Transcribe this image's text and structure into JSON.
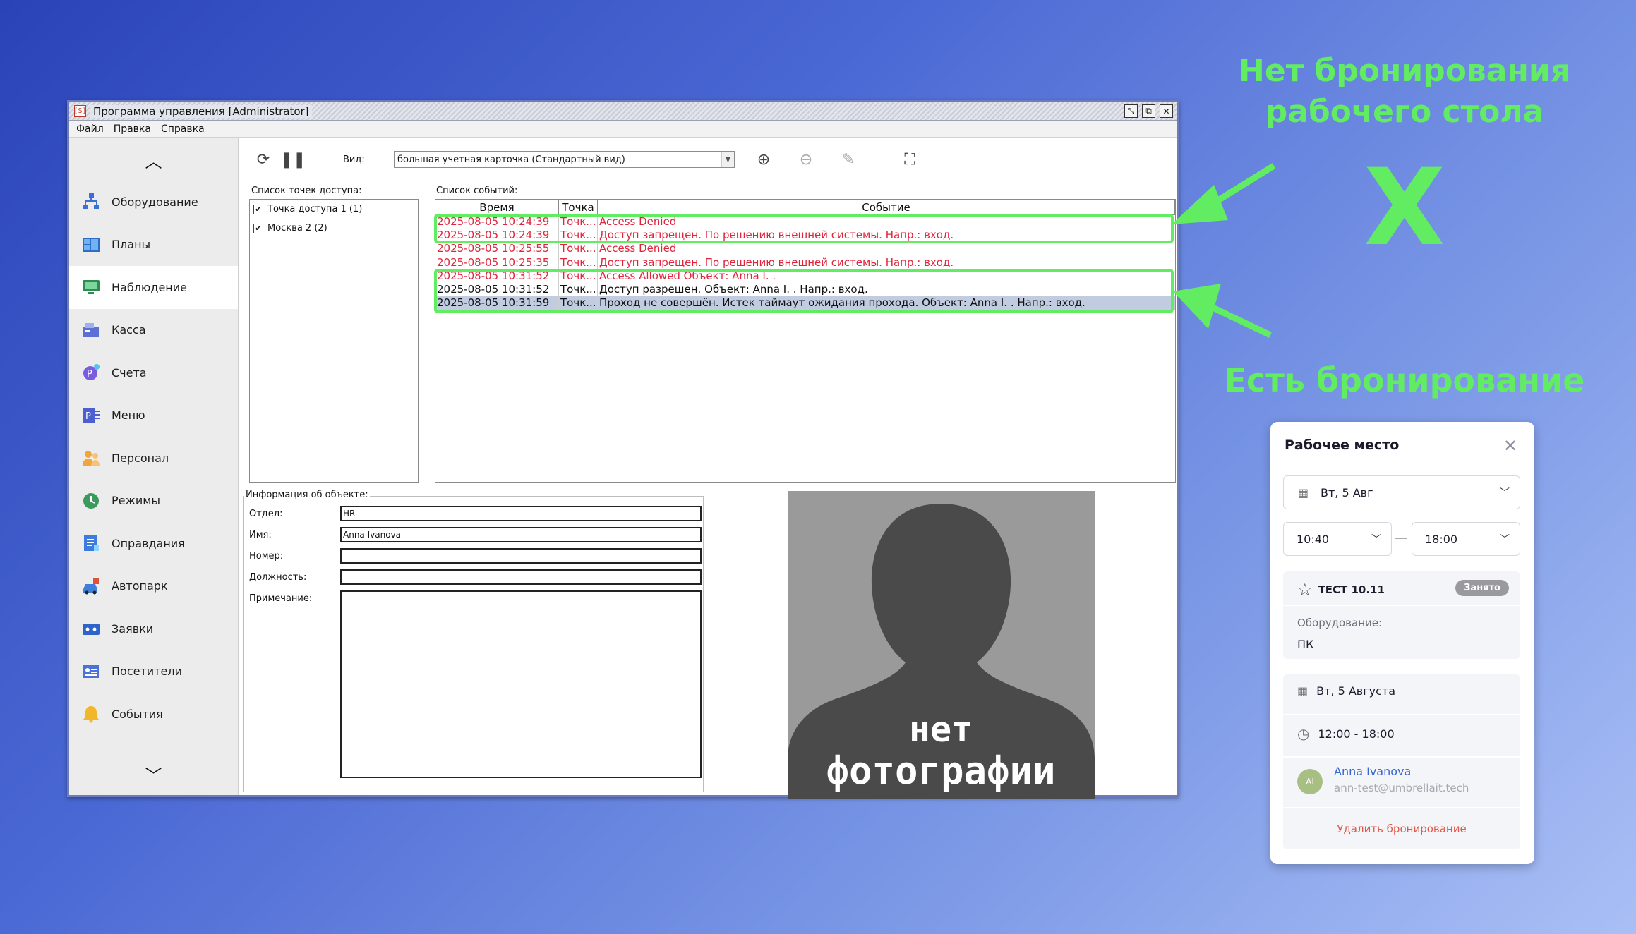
{
  "window": {
    "logo": "[S]",
    "title": "Программа управления [Administrator]",
    "menu": [
      "Файл",
      "Правка",
      "Справка"
    ]
  },
  "sidebar": {
    "items": [
      {
        "label": "Оборудование",
        "icon": "hierarchy-icon"
      },
      {
        "label": "Планы",
        "icon": "floorplan-icon"
      },
      {
        "label": "Наблюдение",
        "icon": "monitor-icon",
        "active": true
      },
      {
        "label": "Касса",
        "icon": "cash-register-icon"
      },
      {
        "label": "Счета",
        "icon": "accounts-icon"
      },
      {
        "label": "Меню",
        "icon": "menu-document-icon"
      },
      {
        "label": "Персонал",
        "icon": "staff-icon"
      },
      {
        "label": "Режимы",
        "icon": "clock-icon"
      },
      {
        "label": "Оправдания",
        "icon": "document-icon"
      },
      {
        "label": "Автопарк",
        "icon": "car-icon"
      },
      {
        "label": "Заявки",
        "icon": "requests-icon"
      },
      {
        "label": "Посетители",
        "icon": "visitors-icon"
      },
      {
        "label": "События",
        "icon": "bell-icon"
      }
    ]
  },
  "toolbar": {
    "view_label": "Вид:",
    "view_value": "большая учетная карточка (Стандартный вид)"
  },
  "access_points": {
    "label": "Список точек доступа:",
    "items": [
      "Точка доступа 1 (1)",
      "Москва 2 (2)"
    ]
  },
  "events": {
    "label": "Список событий:",
    "headers": [
      "Время",
      "Точка",
      "Событие"
    ],
    "rows": [
      {
        "time": "2025-08-05 10:24:39",
        "point": "Точк...",
        "event": "Access Denied",
        "red": true
      },
      {
        "time": "2025-08-05 10:24:39",
        "point": "Точк...",
        "event": "Доступ запрещен. По решению внешней системы. Напр.: вход.",
        "red": true
      },
      {
        "time": "2025-08-05 10:25:55",
        "point": "Точк...",
        "event": "Access Denied",
        "red": true
      },
      {
        "time": "2025-08-05 10:25:35",
        "point": "Точк...",
        "event": "Доступ запрещен. По решению внешней системы. Напр.: вход.",
        "red": true
      },
      {
        "time": "2025-08-05 10:31:52",
        "point": "Точк...",
        "event": "Access Allowed Объект: Anna I. .",
        "red": true
      },
      {
        "time": "2025-08-05 10:31:52",
        "point": "Точк...",
        "event": "Доступ разрешен. Объект: Anna I. . Напр.: вход.",
        "red": false
      },
      {
        "time": "2025-08-05 10:31:59",
        "point": "Точк...",
        "event": "Проход не совершён. Истек таймаут ожидания прохода. Объект: Anna I. . Напр.: вход.",
        "red": false,
        "selected": true
      }
    ]
  },
  "object_info": {
    "title": "Информация об объекте:",
    "labels": {
      "dept": "Отдел:",
      "name": "Имя:",
      "number": "Номер:",
      "position": "Должность:",
      "note": "Примечание:"
    },
    "values": {
      "dept": "HR",
      "name": "Anna Ivanova",
      "number": "",
      "position": "",
      "note": ""
    }
  },
  "photo": {
    "line1": "нет",
    "line2": "фотографии"
  },
  "annotations": {
    "no_booking_line1": "Нет бронирования",
    "no_booking_line2": "рабочего стола",
    "cross": "X",
    "has_booking": "Есть бронирование",
    "color": "#62ec62"
  },
  "booking_card": {
    "title": "Рабочее место",
    "date_select": "Вт, 5 Авг",
    "time_from": "10:40",
    "time_to": "18:00",
    "dash": "—",
    "desk_name": "ТЕСТ 10.11",
    "status_badge": "Занято",
    "equipment_label": "Оборудование:",
    "equipment_value": "ПК",
    "booking_date": "Вт, 5 Августа",
    "booking_time": "12:00 - 18:00",
    "user_initials": "AI",
    "user_name": "Anna Ivanova",
    "user_email": "ann-test@umbrellait.tech",
    "delete_label": "Удалить бронирование"
  }
}
